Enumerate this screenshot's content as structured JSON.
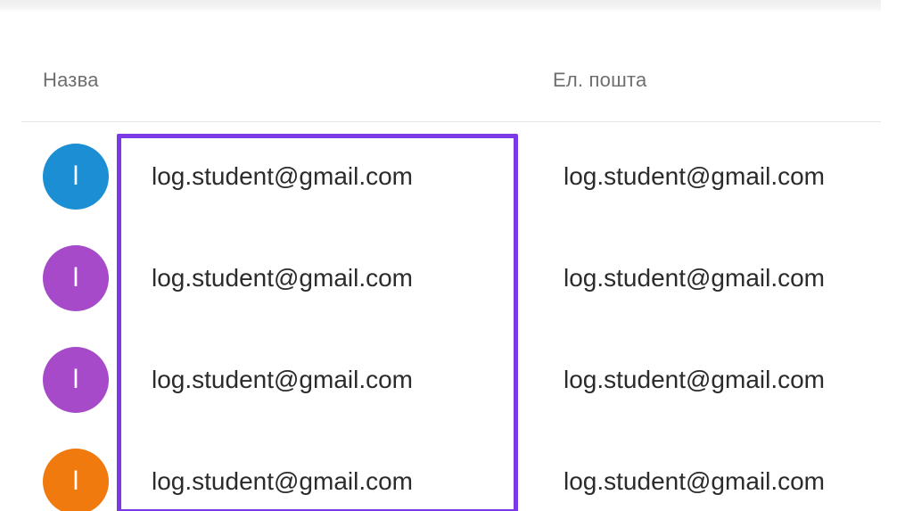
{
  "table": {
    "columns": {
      "name": "Назва",
      "email": "Ел. пошта"
    },
    "rows": [
      {
        "avatar_letter": "l",
        "avatar_color": "#1c8ed4",
        "name": "log.student@gmail.com",
        "email": "log.student@gmail.com"
      },
      {
        "avatar_letter": "l",
        "avatar_color": "#a64ac9",
        "name": "log.student@gmail.com",
        "email": "log.student@gmail.com"
      },
      {
        "avatar_letter": "l",
        "avatar_color": "#a64ac9",
        "name": "log.student@gmail.com",
        "email": "log.student@gmail.com"
      },
      {
        "avatar_letter": "l",
        "avatar_color": "#f07a0e",
        "name": "log.student@gmail.com",
        "email": "log.student@gmail.com"
      }
    ]
  },
  "highlight": {
    "color": "#7c3ae6"
  }
}
